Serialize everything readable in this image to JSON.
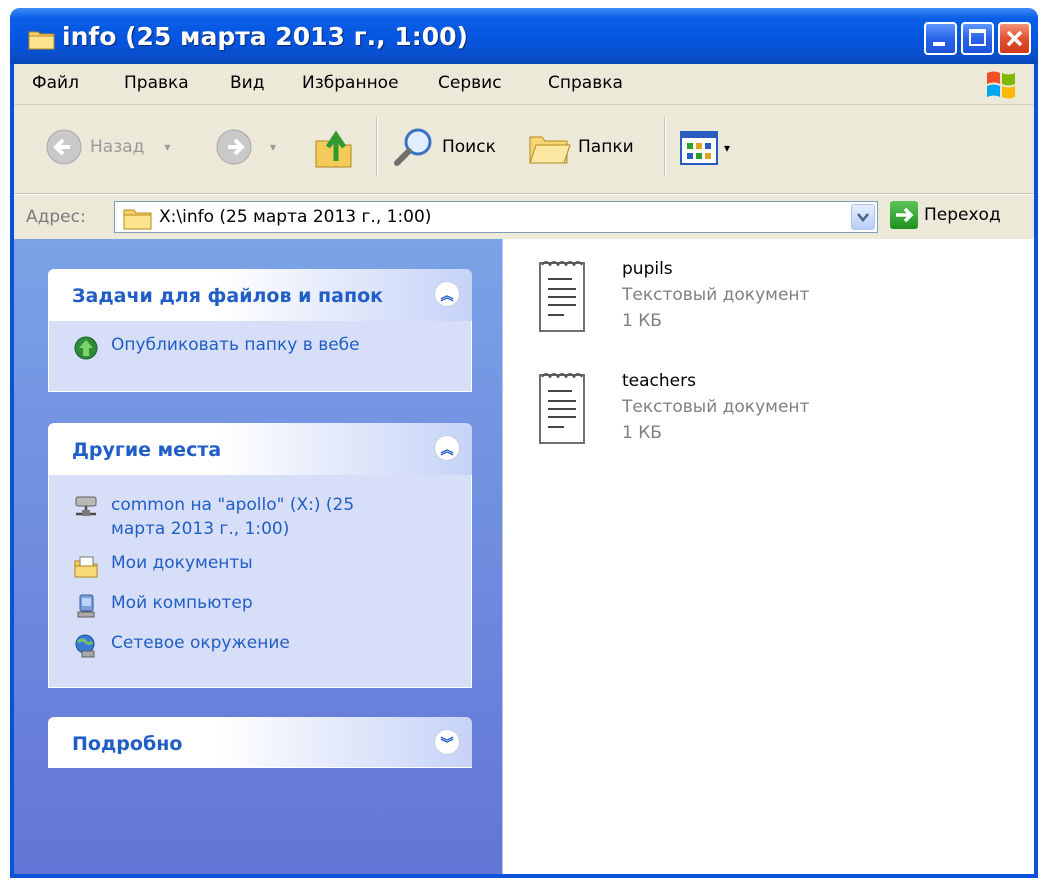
{
  "window": {
    "title": "info (25 марта 2013 г., 1:00)"
  },
  "menu": [
    "Файл",
    "Правка",
    "Вид",
    "Избранное",
    "Сервис",
    "Справка"
  ],
  "toolbar": {
    "back": "Назад",
    "search": "Поиск",
    "folders": "Папки"
  },
  "address": {
    "label": "Адрес:",
    "value": "X:\\info (25 марта 2013 г., 1:00)",
    "go": "Переход"
  },
  "tasks_panel": {
    "title": "Задачи для файлов и папок",
    "items": [
      {
        "label": "Опубликовать папку в вебе",
        "icon": "publish-web-icon"
      }
    ]
  },
  "places_panel": {
    "title": "Другие места",
    "items": [
      {
        "label": "common на \"apollo\" (X:) (25",
        "label2": "марта 2013 г., 1:00)",
        "icon": "network-drive-icon"
      },
      {
        "label": "Мои документы",
        "icon": "my-documents-icon"
      },
      {
        "label": "Мой компьютер",
        "icon": "my-computer-icon"
      },
      {
        "label": "Сетевое окружение",
        "icon": "network-places-icon"
      }
    ]
  },
  "details_panel": {
    "title": "Подробно"
  },
  "files": [
    {
      "name": "pupils",
      "type": "Текстовый документ",
      "size": "1 КБ",
      "icon": "text-document-icon"
    },
    {
      "name": "teachers",
      "type": "Текстовый документ",
      "size": "1 КБ",
      "icon": "text-document-icon"
    }
  ],
  "colors": {
    "titlebar": "#0555e0",
    "taskpane_top": "#7ba2e7",
    "taskpane_bottom": "#6375d6",
    "link": "#215dc6",
    "chrome": "#ece9d8"
  }
}
